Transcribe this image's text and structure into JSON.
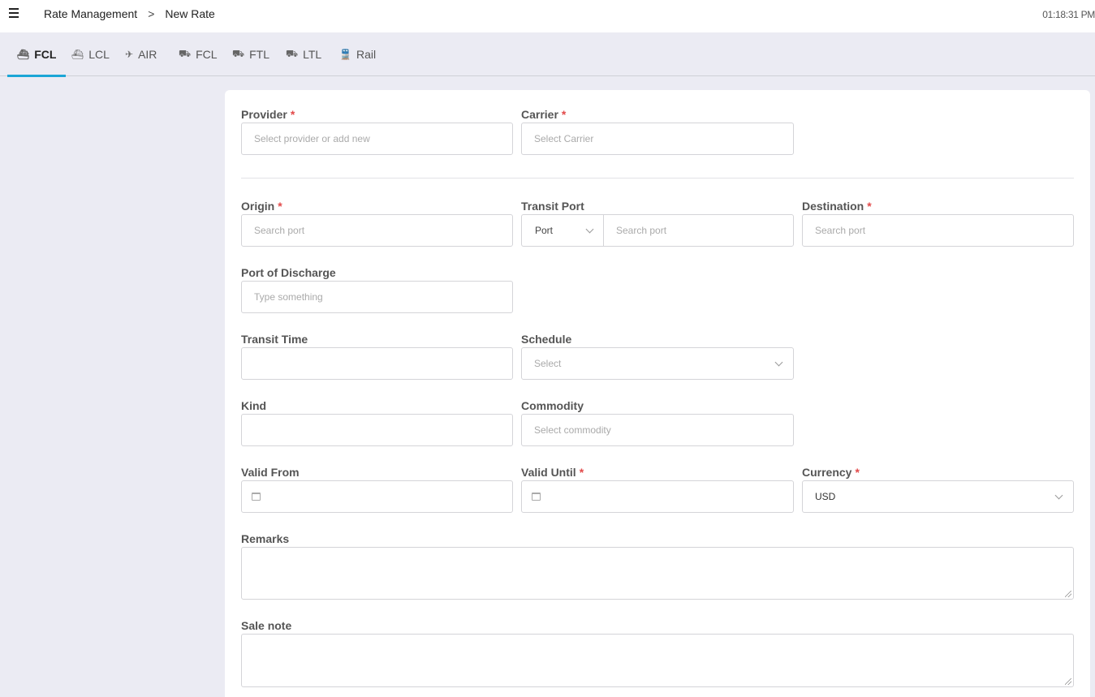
{
  "header": {
    "breadcrumb": [
      "Rate Management",
      "New Rate"
    ],
    "separator": ">",
    "time": "01:18:31 PM"
  },
  "tabs": [
    {
      "label": "FCL",
      "icon": "ship-icon",
      "glyph": "⛴"
    },
    {
      "label": "LCL",
      "icon": "ship-icon",
      "glyph": "⛴"
    },
    {
      "label": "AIR",
      "icon": "plane-departure-icon",
      "glyph": "✈"
    },
    {
      "label": "FCL",
      "icon": "truck-icon",
      "glyph": "⛟"
    },
    {
      "label": "FTL",
      "icon": "truck-icon",
      "glyph": "⛟"
    },
    {
      "label": "LTL",
      "icon": "truck-icon",
      "glyph": "⛟"
    },
    {
      "label": "Rail",
      "icon": "train-icon",
      "glyph": "🚆"
    }
  ],
  "active_tab": "FCL",
  "form": {
    "provider": {
      "label": "Provider",
      "required": "*",
      "placeholder": "Select provider or add new"
    },
    "carrier": {
      "label": "Carrier",
      "required": "*",
      "placeholder": "Select Carrier"
    },
    "origin": {
      "label": "Origin",
      "required": "*",
      "placeholder": "Search port"
    },
    "transit_port": {
      "label": "Transit Port",
      "type_value": "Port",
      "placeholder": "Search port"
    },
    "destination": {
      "label": "Destination",
      "required": "*",
      "placeholder": "Search port"
    },
    "port_of_discharge": {
      "label": "Port of Discharge",
      "placeholder": "Type something"
    },
    "transit_time": {
      "label": "Transit Time",
      "value": ""
    },
    "schedule": {
      "label": "Schedule",
      "placeholder": "Select"
    },
    "kind": {
      "label": "Kind",
      "value": ""
    },
    "commodity": {
      "label": "Commodity",
      "placeholder": "Select commodity"
    },
    "valid_from": {
      "label": "Valid From",
      "value": ""
    },
    "valid_until": {
      "label": "Valid Until",
      "required": "*",
      "value": ""
    },
    "currency": {
      "label": "Currency",
      "required": "*",
      "value": "USD"
    },
    "remarks": {
      "label": "Remarks",
      "value": ""
    },
    "sale_note": {
      "label": "Sale note",
      "value": ""
    }
  },
  "colors": {
    "accent": "#1ba6d6",
    "required": "#e24a4a",
    "background": "#ebebf3"
  }
}
